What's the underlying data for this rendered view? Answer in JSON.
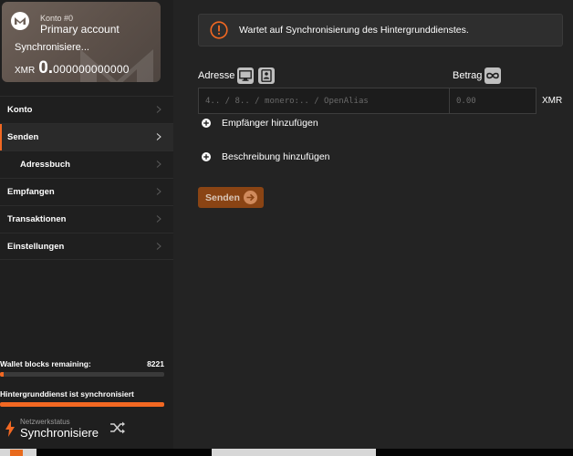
{
  "sidebar": {
    "account": {
      "number_label": "Konto #0",
      "name": "Primary account",
      "sync_status": "Synchronisiere...",
      "currency": "XMR",
      "balance_int": "0.",
      "balance_frac": "000000000000"
    },
    "nav": [
      {
        "label": "Konto"
      },
      {
        "label": "Senden"
      },
      {
        "label": "Adressbuch"
      },
      {
        "label": "Empfangen"
      },
      {
        "label": "Transaktionen"
      },
      {
        "label": "Einstellungen"
      }
    ],
    "wallet_sync": {
      "label": "Wallet blocks remaining:",
      "value": "8221",
      "progress_fraction": 0.02
    },
    "daemon_sync": {
      "label": "Hintergrunddienst ist synchronisiert",
      "progress_fraction": 1.0
    },
    "network": {
      "label": "Netzwerkstatus",
      "value": "Synchronisiere",
      "status_icon": "lightning-icon",
      "switch_icon": "shuffle-icon"
    }
  },
  "main": {
    "alert": {
      "text": "Wartet auf Synchronisierung des Hintergrunddienstes.",
      "icon": "warning-circle-icon"
    },
    "address": {
      "label": "Adresse",
      "placeholder": "4.. / 8.. / monero:.. / OpenAlias",
      "value": ""
    },
    "amount": {
      "label": "Betrag",
      "placeholder": "0.00",
      "value": "",
      "currency": "XMR"
    },
    "add_recipient_label": "Empfänger hinzufügen",
    "add_description_label": "Beschreibung hinzufügen",
    "send_label": "Senden"
  },
  "colors": {
    "accent": "#f26822",
    "sidebar_bg": "#1f1f1f",
    "main_bg": "#232323",
    "send_button_bg": "#8a4414"
  }
}
